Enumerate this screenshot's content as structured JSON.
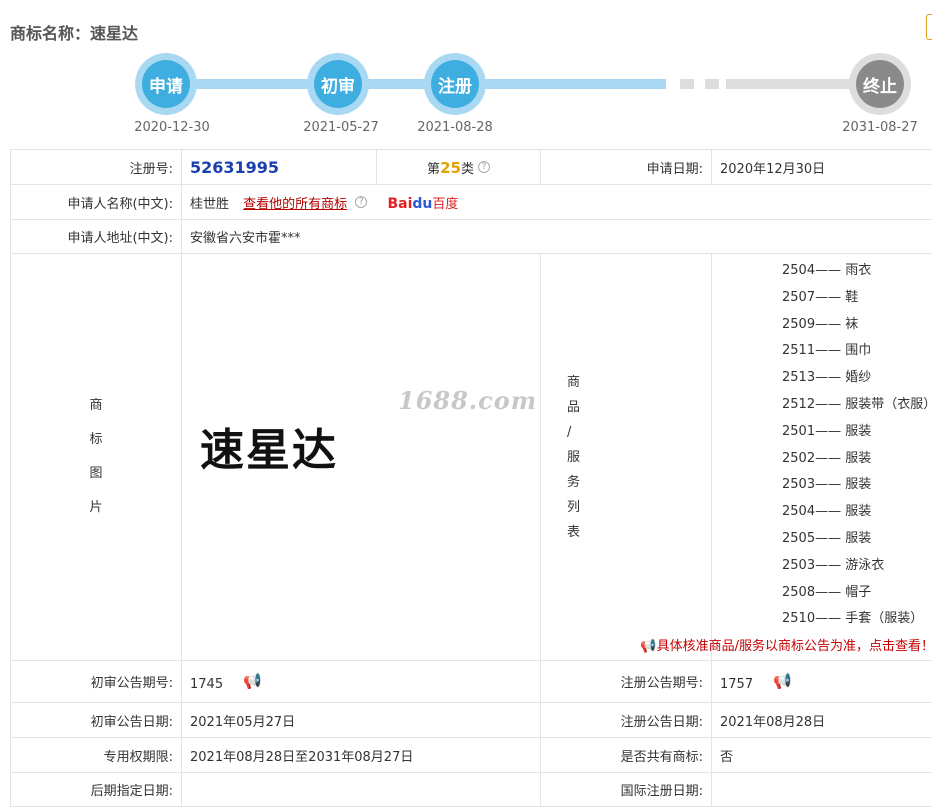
{
  "page": {
    "title": "商标名称：速星达"
  },
  "timeline": [
    {
      "label": "申请",
      "date": "2020-12-30",
      "state": "done"
    },
    {
      "label": "初审",
      "date": "2021-05-27",
      "state": "done"
    },
    {
      "label": "注册",
      "date": "2021-08-28",
      "state": "done"
    },
    {
      "label": "终止",
      "date": "2031-08-27",
      "state": "pending"
    }
  ],
  "info": {
    "reg_no_label": "注册号:",
    "reg_no": "52631995",
    "class_prefix": "第",
    "class_no": "25",
    "class_suffix": "类",
    "apply_date_label": "申请日期:",
    "apply_date": "2020年12月30日",
    "applicant_label": "申请人名称(中文):",
    "applicant": "桂世胜",
    "view_all_link": "查看他的所有商标",
    "baidu_logo": {
      "bai": "Bai",
      "du": "du",
      "cn": "百度"
    },
    "address_label": "申请人地址(中文):",
    "address": "安徽省六安市霍***",
    "image_label": [
      "商",
      "标",
      "图",
      "片"
    ],
    "trademark_text": "速星达",
    "watermark": "1688.com",
    "goods_label": [
      "商",
      "品",
      "/",
      "服",
      "务",
      "列",
      "表"
    ],
    "goods": [
      {
        "code": "2504",
        "name": "雨衣"
      },
      {
        "code": "2507",
        "name": "鞋"
      },
      {
        "code": "2509",
        "name": "袜"
      },
      {
        "code": "2511",
        "name": "围巾"
      },
      {
        "code": "2513",
        "name": "婚纱"
      },
      {
        "code": "2512",
        "name": "服装带（衣服）"
      },
      {
        "code": "2501",
        "name": "服装"
      },
      {
        "code": "2502",
        "name": "服装"
      },
      {
        "code": "2503",
        "name": "服装"
      },
      {
        "code": "2504",
        "name": "服装"
      },
      {
        "code": "2505",
        "name": "服装"
      },
      {
        "code": "2503",
        "name": "游泳衣"
      },
      {
        "code": "2508",
        "name": "帽子"
      },
      {
        "code": "2510",
        "name": "手套（服装）"
      }
    ],
    "goods_notice": "具体核准商品/服务以商标公告为准，点击查看！",
    "prelim_no_label": "初审公告期号:",
    "prelim_no": "1745",
    "reg_ann_no_label": "注册公告期号:",
    "reg_ann_no": "1757",
    "prelim_date_label": "初审公告日期:",
    "prelim_date": "2021年05月27日",
    "reg_ann_date_label": "注册公告日期:",
    "reg_ann_date": "2021年08月28日",
    "exclusive_label": "专用权期限:",
    "exclusive": "2021年08月28日至2031年08月27日",
    "shared_label": "是否共有商标:",
    "shared": "否",
    "later_date_label": "后期指定日期:",
    "later_date": "",
    "intl_date_label": "国际注册日期:",
    "intl_date": ""
  },
  "colors": {
    "accent": "#3eaee0",
    "track": "#a9d9f2",
    "link": "#b20000",
    "reg_no": "#1a3fae",
    "class": "#e3a200"
  }
}
